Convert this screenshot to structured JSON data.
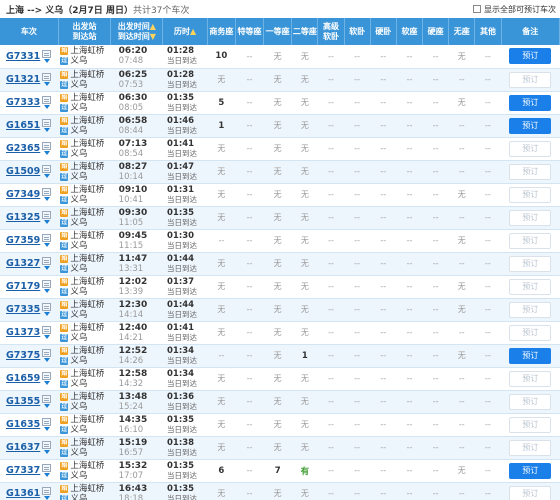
{
  "header": {
    "route": "上海 --> 义乌",
    "date": "（2月7日  周日）",
    "count": "共计37个车次",
    "show_all_label": "显示全部可预订车次"
  },
  "columns": [
    "车次",
    "出发站",
    "到达站",
    "出发时间",
    "到达时间",
    "历时",
    "商务座",
    "特等座",
    "一等座",
    "二等座",
    "高级",
    "软卧",
    "软卧",
    "硬卧",
    "软座",
    "硬座",
    "无座",
    "其他",
    "备注"
  ],
  "rows": [
    {
      "train": "G7331",
      "from": "上海虹桥",
      "to": "义乌",
      "dep": "06:20",
      "arr": "07:48",
      "dur": "01:28",
      "note": "当日到达",
      "seats": [
        "10",
        "--",
        "无",
        "无",
        "--",
        "--",
        "--",
        "--",
        "--",
        "无",
        "--"
      ],
      "action": "预订",
      "bookable": true
    },
    {
      "train": "G1321",
      "from": "上海虹桥",
      "to": "义乌",
      "dep": "06:25",
      "arr": "07:53",
      "dur": "01:28",
      "note": "当日到达",
      "seats": [
        "无",
        "--",
        "无",
        "无",
        "--",
        "--",
        "--",
        "--",
        "--",
        "--",
        "--"
      ],
      "action": "预订",
      "bookable": false
    },
    {
      "train": "G7333",
      "from": "上海虹桥",
      "to": "义乌",
      "dep": "06:30",
      "arr": "08:05",
      "dur": "01:35",
      "note": "当日到达",
      "seats": [
        "5",
        "--",
        "无",
        "无",
        "--",
        "--",
        "--",
        "--",
        "--",
        "无",
        "--"
      ],
      "action": "预订",
      "bookable": true
    },
    {
      "train": "G1651",
      "from": "上海虹桥",
      "to": "义乌",
      "dep": "06:58",
      "arr": "08:44",
      "dur": "01:46",
      "note": "当日到达",
      "seats": [
        "1",
        "--",
        "无",
        "无",
        "--",
        "--",
        "--",
        "--",
        "--",
        "--",
        "--"
      ],
      "action": "预订",
      "bookable": true
    },
    {
      "train": "G2365",
      "from": "上海虹桥",
      "to": "义乌",
      "dep": "07:13",
      "arr": "08:54",
      "dur": "01:41",
      "note": "当日到达",
      "seats": [
        "无",
        "--",
        "无",
        "无",
        "--",
        "--",
        "--",
        "--",
        "--",
        "--",
        "--"
      ],
      "action": "预订",
      "bookable": false
    },
    {
      "train": "G1509",
      "from": "上海虹桥",
      "to": "义乌",
      "dep": "08:27",
      "arr": "10:14",
      "dur": "01:47",
      "note": "当日到达",
      "seats": [
        "无",
        "--",
        "无",
        "无",
        "--",
        "--",
        "--",
        "--",
        "--",
        "--",
        "--"
      ],
      "action": "预订",
      "bookable": false
    },
    {
      "train": "G7349",
      "from": "上海虹桥",
      "to": "义乌",
      "dep": "09:10",
      "arr": "10:41",
      "dur": "01:31",
      "note": "当日到达",
      "seats": [
        "无",
        "--",
        "无",
        "无",
        "--",
        "--",
        "--",
        "--",
        "--",
        "无",
        "--"
      ],
      "action": "预订",
      "bookable": false
    },
    {
      "train": "G1325",
      "from": "上海虹桥",
      "to": "义乌",
      "dep": "09:30",
      "arr": "11:05",
      "dur": "01:35",
      "note": "当日到达",
      "seats": [
        "无",
        "--",
        "无",
        "无",
        "--",
        "--",
        "--",
        "--",
        "--",
        "--",
        "--"
      ],
      "action": "预订",
      "bookable": false
    },
    {
      "train": "G7359",
      "from": "上海虹桥",
      "to": "义乌",
      "dep": "09:45",
      "arr": "11:15",
      "dur": "01:30",
      "note": "当日到达",
      "seats": [
        "--",
        "--",
        "无",
        "无",
        "--",
        "--",
        "--",
        "--",
        "--",
        "无",
        "--"
      ],
      "action": "预订",
      "bookable": false
    },
    {
      "train": "G1327",
      "from": "上海虹桥",
      "to": "义乌",
      "dep": "11:47",
      "arr": "13:31",
      "dur": "01:44",
      "note": "当日到达",
      "seats": [
        "无",
        "--",
        "无",
        "无",
        "--",
        "--",
        "--",
        "--",
        "--",
        "--",
        "--"
      ],
      "action": "预订",
      "bookable": false
    },
    {
      "train": "G7179",
      "from": "上海虹桥",
      "to": "义乌",
      "dep": "12:02",
      "arr": "13:39",
      "dur": "01:37",
      "note": "当日到达",
      "seats": [
        "无",
        "--",
        "无",
        "无",
        "--",
        "--",
        "--",
        "--",
        "--",
        "无",
        "--"
      ],
      "action": "预订",
      "bookable": false
    },
    {
      "train": "G7335",
      "from": "上海虹桥",
      "to": "义乌",
      "dep": "12:30",
      "arr": "14:14",
      "dur": "01:44",
      "note": "当日到达",
      "seats": [
        "无",
        "--",
        "无",
        "无",
        "--",
        "--",
        "--",
        "--",
        "--",
        "无",
        "--"
      ],
      "action": "预订",
      "bookable": false
    },
    {
      "train": "G1373",
      "from": "上海虹桥",
      "to": "义乌",
      "dep": "12:40",
      "arr": "14:21",
      "dur": "01:41",
      "note": "当日到达",
      "seats": [
        "无",
        "--",
        "无",
        "无",
        "--",
        "--",
        "--",
        "--",
        "--",
        "--",
        "--"
      ],
      "action": "预订",
      "bookable": false
    },
    {
      "train": "G7375",
      "from": "上海虹桥",
      "to": "义乌",
      "dep": "12:52",
      "arr": "14:26",
      "dur": "01:34",
      "note": "当日到达",
      "seats": [
        "--",
        "--",
        "无",
        "1",
        "--",
        "--",
        "--",
        "--",
        "--",
        "无",
        "--"
      ],
      "action": "预订",
      "bookable": true
    },
    {
      "train": "G1659",
      "from": "上海虹桥",
      "to": "义乌",
      "dep": "12:58",
      "arr": "14:32",
      "dur": "01:34",
      "note": "当日到达",
      "seats": [
        "无",
        "--",
        "无",
        "无",
        "--",
        "--",
        "--",
        "--",
        "--",
        "--",
        "--"
      ],
      "action": "预订",
      "bookable": false
    },
    {
      "train": "G1355",
      "from": "上海虹桥",
      "to": "义乌",
      "dep": "13:48",
      "arr": "15:24",
      "dur": "01:36",
      "note": "当日到达",
      "seats": [
        "无",
        "--",
        "无",
        "无",
        "--",
        "--",
        "--",
        "--",
        "--",
        "--",
        "--"
      ],
      "action": "预订",
      "bookable": false
    },
    {
      "train": "G1635",
      "from": "上海虹桥",
      "to": "义乌",
      "dep": "14:35",
      "arr": "16:10",
      "dur": "01:35",
      "note": "当日到达",
      "seats": [
        "无",
        "--",
        "无",
        "无",
        "--",
        "--",
        "--",
        "--",
        "--",
        "--",
        "--"
      ],
      "action": "预订",
      "bookable": false
    },
    {
      "train": "G1637",
      "from": "上海虹桥",
      "to": "义乌",
      "dep": "15:19",
      "arr": "16:57",
      "dur": "01:38",
      "note": "当日到达",
      "seats": [
        "无",
        "--",
        "无",
        "无",
        "--",
        "--",
        "--",
        "--",
        "--",
        "--",
        "--"
      ],
      "action": "预订",
      "bookable": false
    },
    {
      "train": "G7337",
      "from": "上海虹桥",
      "to": "义乌",
      "dep": "15:32",
      "arr": "17:07",
      "dur": "01:35",
      "note": "当日到达",
      "seats": [
        "6",
        "--",
        "7",
        "有",
        "--",
        "--",
        "--",
        "--",
        "--",
        "无",
        "--"
      ],
      "action": "预订",
      "bookable": true
    },
    {
      "train": "G1361",
      "from": "上海虹桥",
      "to": "义乌",
      "dep": "16:43",
      "arr": "18:18",
      "dur": "01:35",
      "note": "当日到达",
      "seats": [
        "无",
        "--",
        "无",
        "无",
        "--",
        "--",
        "--",
        "--",
        "--",
        "--",
        "--"
      ],
      "action": "预订",
      "bookable": false
    }
  ]
}
